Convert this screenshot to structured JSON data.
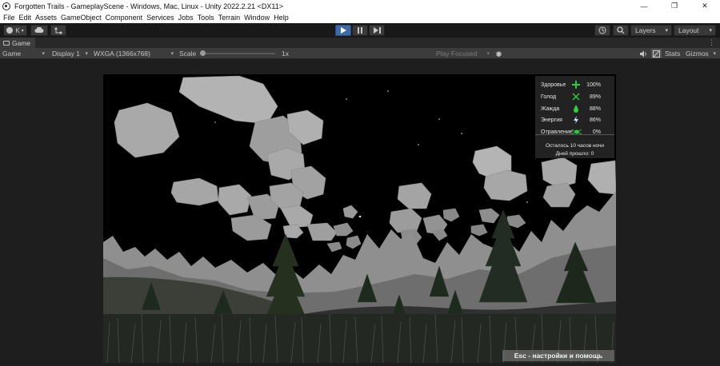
{
  "window": {
    "title": "Forgotten Trails - GameplayScene - Windows, Mac, Linux - Unity 2022.2.21 <DX11>",
    "minimize": "—",
    "maximize": "❐",
    "close": "✕"
  },
  "menu": [
    "File",
    "Edit",
    "Assets",
    "GameObject",
    "Component",
    "Services",
    "Jobs",
    "Tools",
    "Terrain",
    "Window",
    "Help"
  ],
  "toolbar": {
    "account_label": "K",
    "layers_label": "Layers",
    "layout_label": "Layout",
    "play_active": true,
    "accent_color": "#3d6aa8"
  },
  "tab": {
    "label": "Game"
  },
  "game_toolbar": {
    "mode": "Game",
    "display": "Display 1",
    "resolution": "WXGA (1366x768)",
    "scale_label": "Scale",
    "scale_value": "1x",
    "play_focused": "Play Focused",
    "stats": "Stats",
    "gizmos": "Gizmos"
  },
  "hud": {
    "stats": [
      {
        "label": "Здоровье",
        "value": "100%",
        "icon": "health-cross-icon",
        "color": "#2ecc40"
      },
      {
        "label": "Голод",
        "value": "89%",
        "icon": "hunger-cutlery-icon",
        "color": "#2ecc40"
      },
      {
        "label": "Жажда",
        "value": "88%",
        "icon": "thirst-drop-icon",
        "color": "#2ecc40"
      },
      {
        "label": "Энергия",
        "value": "86%",
        "icon": "energy-bolt-icon",
        "color": "#cfe3ff"
      },
      {
        "label": "Отравление",
        "value": "0%",
        "icon": "poison-bug-icon",
        "color": "#2ecc40"
      }
    ],
    "time_left": "Осталось 10 часов ночи",
    "days_passed": "Дней прошло: 0"
  },
  "esc_hint": "Esc - настройки и помощь"
}
